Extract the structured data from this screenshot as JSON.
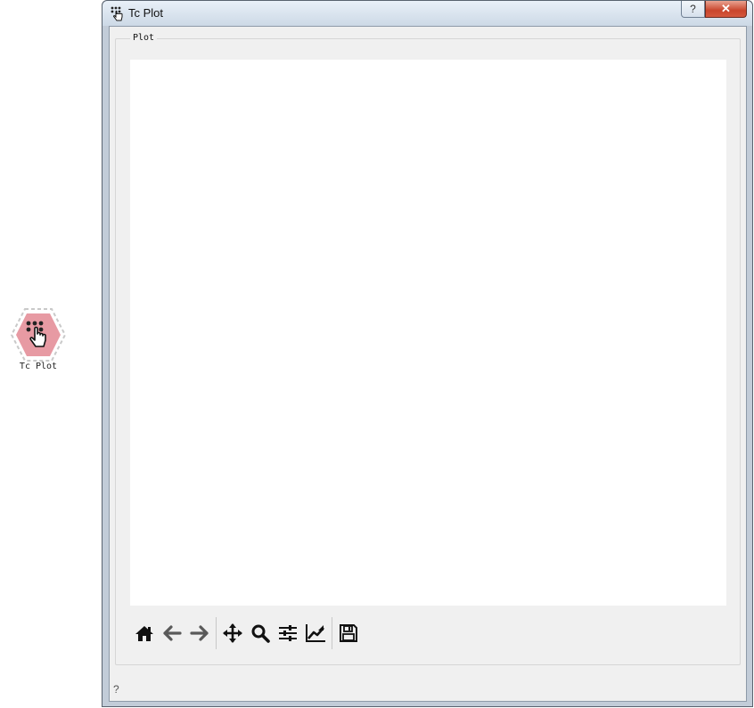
{
  "canvas": {
    "widget": {
      "label": "Tc Plot",
      "icon": "hand-pointer-dots-icon",
      "color": "#e79aa3"
    }
  },
  "window": {
    "title": "Tc Plot",
    "title_icon": "hand-pointer-dots-icon",
    "buttons": {
      "help": "?",
      "close": "✕"
    },
    "group": {
      "title": "Plot",
      "plot_area": "blank"
    },
    "toolbar": [
      {
        "name": "home",
        "icon": "home-icon"
      },
      {
        "name": "back",
        "icon": "arrow-left-icon"
      },
      {
        "name": "forward",
        "icon": "arrow-right-icon"
      },
      {
        "name": "pan",
        "icon": "move-arrows-icon"
      },
      {
        "name": "zoom",
        "icon": "magnifier-icon"
      },
      {
        "name": "subplots",
        "icon": "sliders-icon"
      },
      {
        "name": "customize",
        "icon": "line-chart-icon"
      },
      {
        "name": "save",
        "icon": "floppy-disk-icon"
      }
    ],
    "status_help": "?"
  },
  "colors": {
    "accent_close": "#c9452c",
    "window_bg": "#f0f0f0"
  }
}
